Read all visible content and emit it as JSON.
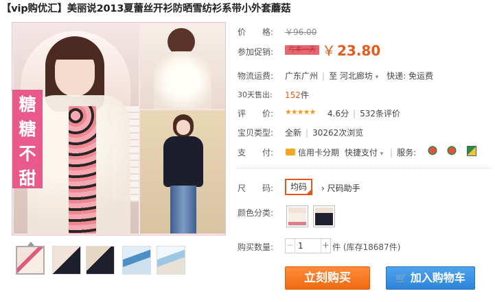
{
  "product": {
    "title": "【vip购优汇】美丽说2013夏蕾丝开衫防晒雪纺衫系带小外套蘑菇"
  },
  "gallery": {
    "side_tag": "糖糖不甜"
  },
  "labels": {
    "price": "价　　格:",
    "promo": "参加促销:",
    "shipping": "物流运费:",
    "sold": "30天售出:",
    "rating": "评　　价:",
    "type": "宝贝类型:",
    "pay": "支　　付:",
    "size": "尺　　码:",
    "color": "颜色分类:",
    "qty": "购买数量:"
  },
  "price": {
    "original": "￥96.00",
    "promo_tag": "亏本一天",
    "currency": "￥",
    "current": "23.80"
  },
  "shipping": {
    "from": "广东广州",
    "sep": "至",
    "to": "河北廊坊",
    "express": "快递: 免运费"
  },
  "sales": {
    "count": "152",
    "unit": "件"
  },
  "rating": {
    "stars": "★★★★★",
    "score": "4.6分",
    "reviews": "532条评价"
  },
  "item_type": {
    "condition": "全新",
    "views": "30262次浏览"
  },
  "payment": {
    "installment": "信用卡分期",
    "quick_pay": "快捷支付",
    "service_label": "服务:"
  },
  "options": {
    "size_selected": "均码",
    "size_help": "尺码助手"
  },
  "quantity": {
    "value": "1",
    "unit": "件",
    "stock": "(库存18687件)"
  },
  "actions": {
    "buy_now": "立刻购买",
    "add_to_cart": "加入购物车"
  },
  "colors": {
    "price": "#e35a1a",
    "buy_now": "#f06a12",
    "add_cart": "#2d84d8",
    "tag_pink": "#e95a8c"
  }
}
